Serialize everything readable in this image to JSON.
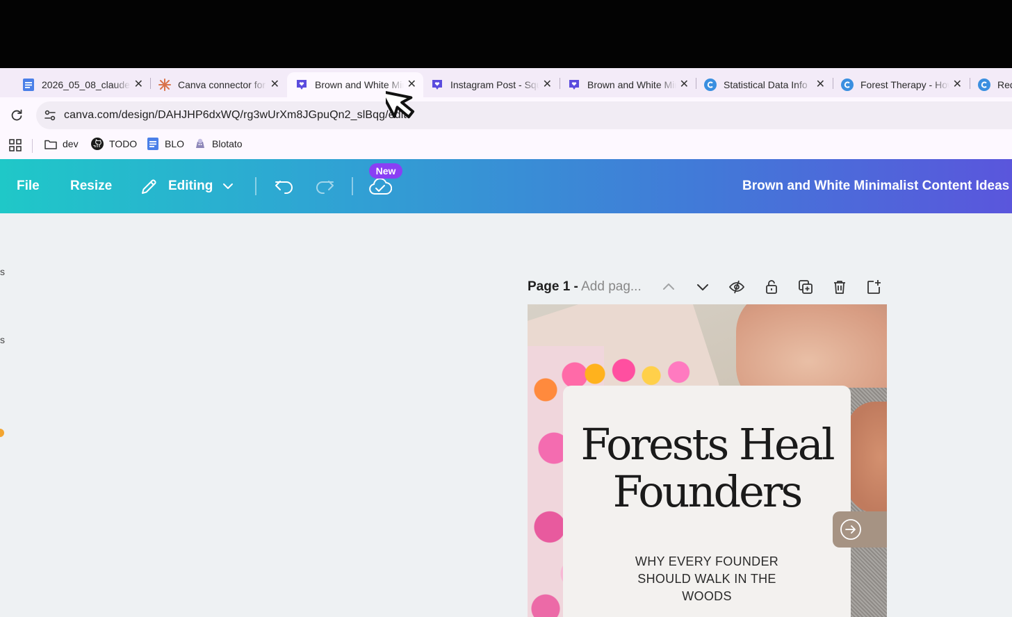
{
  "browser": {
    "tabs": [
      {
        "title": "2026_05_08_claude",
        "favicon": "docs-icon"
      },
      {
        "title": "Canva connector for",
        "favicon": "claude-icon"
      },
      {
        "title": "Brown and White Minimalist",
        "favicon": "canva-heart-icon",
        "active": true
      },
      {
        "title": "Instagram Post - Square",
        "favicon": "canva-heart-icon"
      },
      {
        "title": "Brown and White Minimalist",
        "favicon": "canva-heart-icon"
      },
      {
        "title": "Statistical Data Info",
        "favicon": "canva-c-icon"
      },
      {
        "title": "Forest Therapy - How",
        "favicon": "canva-c-icon"
      },
      {
        "title": "Red",
        "favicon": "canva-c-icon"
      }
    ],
    "url": "canva.com/design/DAHJHP6dxWQ/rg3wUrXm8JGpuQn2_slBqg/edit",
    "bookmarks": [
      {
        "label": "dev",
        "icon": "folder-icon"
      },
      {
        "label": "TODO",
        "icon": "github-icon"
      },
      {
        "label": "BLO",
        "icon": "docs-icon"
      },
      {
        "label": "Blotato",
        "icon": "blotato-icon"
      }
    ]
  },
  "canva_toolbar": {
    "file_label": "File",
    "resize_label": "Resize",
    "editing_label": "Editing",
    "new_badge": "New",
    "design_title": "Brown and White Minimalist Content Ideas"
  },
  "workspace": {
    "left_edge_labels": [
      "s",
      "s"
    ],
    "page_label": "Page 1 -",
    "page_title_placeholder": "Add pag..."
  },
  "design": {
    "headline_line1": "Forests Heal",
    "headline_line2": "Founders",
    "subline": "WHY EVERY FOUNDER SHOULD WALK IN THE WOODS"
  },
  "colors": {
    "toolbar_start": "#1fc8c8",
    "toolbar_end": "#5a56dc",
    "new_badge": "#8a3ff4",
    "tab_strip": "#f3ebf8"
  }
}
